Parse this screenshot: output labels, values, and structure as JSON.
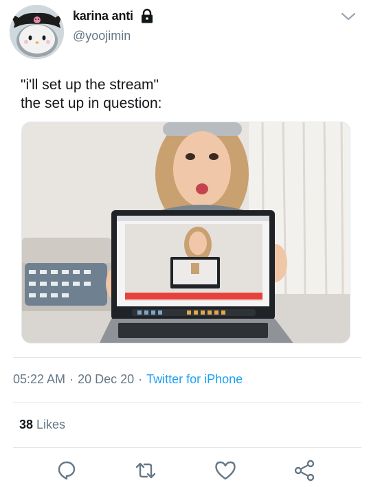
{
  "tweet": {
    "display_name": "karina anti",
    "handle": "@yoojimin",
    "text": "\"i'll set up the stream\"\nthe set up in question:",
    "time": "05:22 AM",
    "date": "20 Dec 20",
    "source": "Twitter for iPhone",
    "likes_count": "38",
    "likes_label": "Likes"
  },
  "icons": {
    "lock": "lock-icon",
    "more": "chevron-down-icon",
    "reply": "reply-icon",
    "retweet": "retweet-icon",
    "like": "heart-icon",
    "share": "share-icon"
  },
  "colors": {
    "text_primary": "#14171a",
    "text_secondary": "#657786",
    "accent": "#1da1f2",
    "divider": "#e1e8ed"
  }
}
